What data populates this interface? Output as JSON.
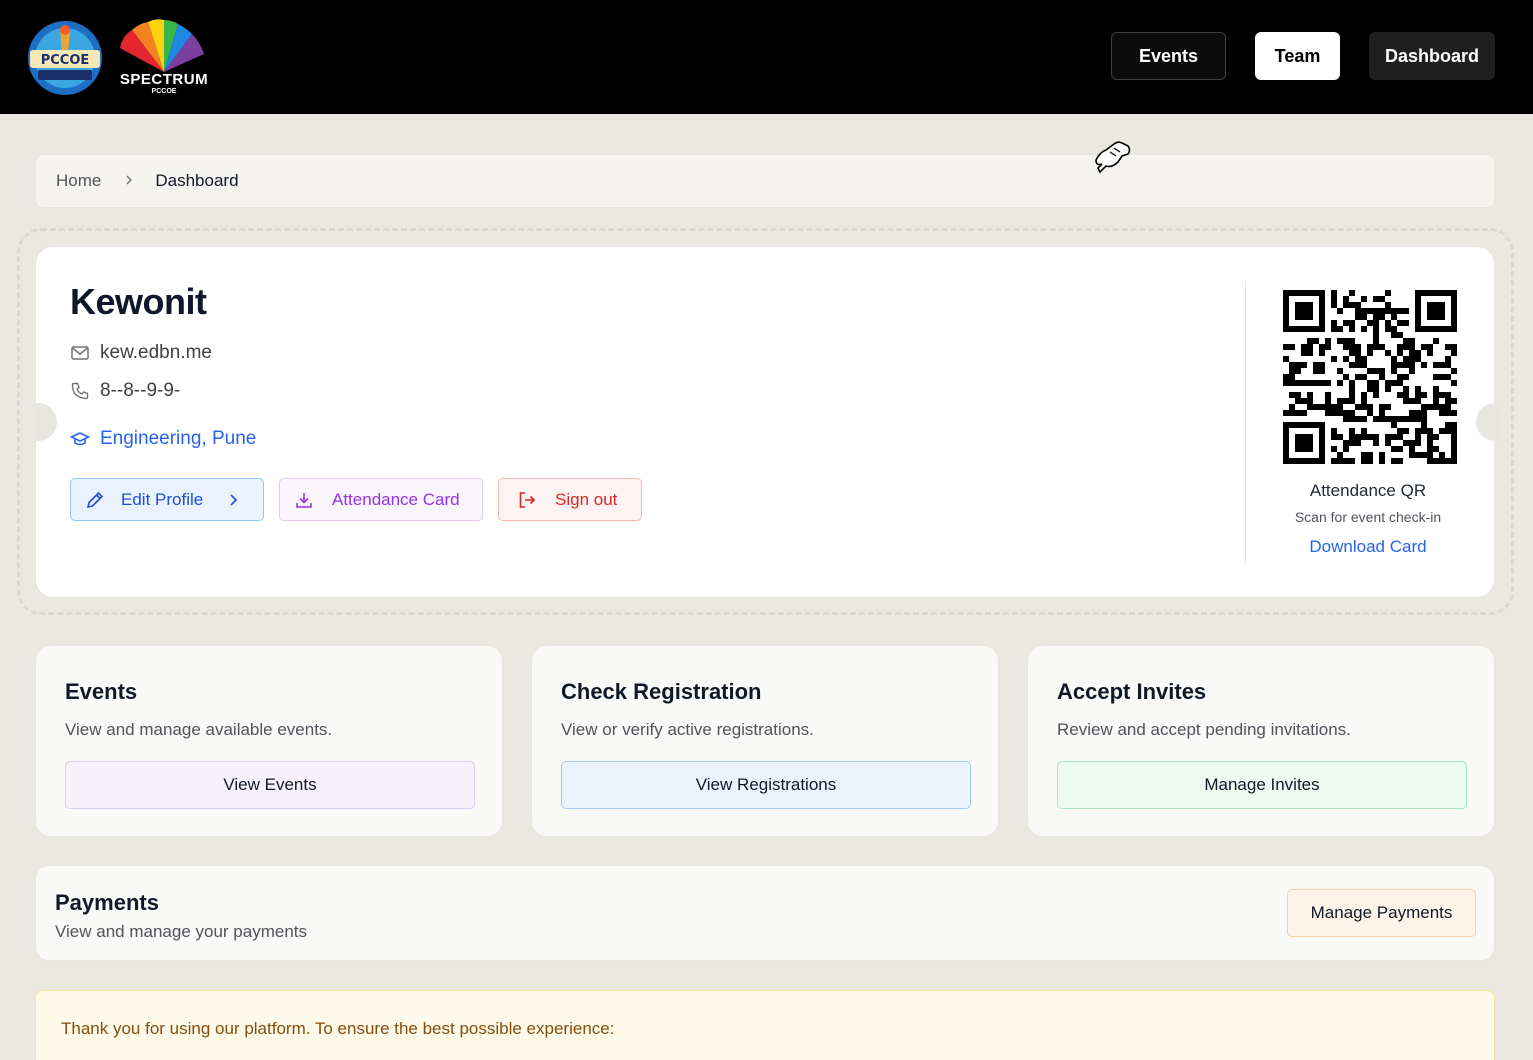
{
  "header": {
    "logo_pccoe_text": "PCCOE",
    "logo_spectrum_text": "SPECTRUM",
    "logo_spectrum_sub": "PCCOE",
    "nav": {
      "events": "Events",
      "team": "Team",
      "dashboard": "Dashboard"
    }
  },
  "breadcrumb": {
    "home": "Home",
    "current": "Dashboard"
  },
  "profile": {
    "name": "Kewonit",
    "email": "kew.edbn.me",
    "phone": "8--8--9-9-",
    "college": "Engineering, Pune",
    "buttons": {
      "edit": "Edit Profile",
      "attendance": "Attendance Card",
      "signout": "Sign out"
    },
    "qr": {
      "title": "Attendance QR",
      "subtitle": "Scan for event check-in",
      "download": "Download Card"
    }
  },
  "cards": [
    {
      "title": "Events",
      "description": "View and manage available events.",
      "button": "View Events"
    },
    {
      "title": "Check Registration",
      "description": "View or verify active registrations.",
      "button": "View Registrations"
    },
    {
      "title": "Accept Invites",
      "description": "Review and accept pending invitations.",
      "button": "Manage Invites"
    }
  ],
  "payments": {
    "title": "Payments",
    "description": "View and manage your payments",
    "button": "Manage Payments"
  },
  "notice": {
    "text": "Thank you for using our platform. To ensure the best possible experience:"
  },
  "colors": {
    "accent_blue": "#2563eb",
    "signout_red": "#dc2626",
    "attendance_purple": "#9333ea"
  }
}
